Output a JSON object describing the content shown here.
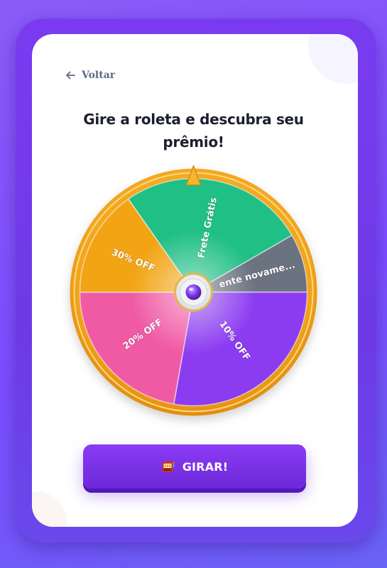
{
  "colors": {
    "background": "#8b5cf6",
    "card": "#ffffff",
    "title": "#1b1f2e",
    "back_link": "#5b6b85",
    "wheel_rim": "#f0a220",
    "pointer": "#f5b52e",
    "button": "#7c3aed"
  },
  "nav": {
    "back_label": "Voltar",
    "back_icon": "arrow-left-icon"
  },
  "page": {
    "title": "Gire a roleta e descubra seu prêmio!"
  },
  "wheel": {
    "segments": [
      {
        "label": "Frete Grátis",
        "color": "#1fbf86"
      },
      {
        "label": "ente novame...",
        "color": "#6b7280"
      },
      {
        "label": "10% OFF",
        "color": "#8b3cf0"
      },
      {
        "label": "20% OFF",
        "color": "#f05aa5"
      },
      {
        "label": "30% OFF",
        "color": "#f2a414"
      }
    ],
    "hub_icon": "purple-gem-icon",
    "pointer_icon": "triangle-pointer-icon"
  },
  "spin_button": {
    "icon": "slot-machine-icon",
    "label": "GIRAR!"
  }
}
